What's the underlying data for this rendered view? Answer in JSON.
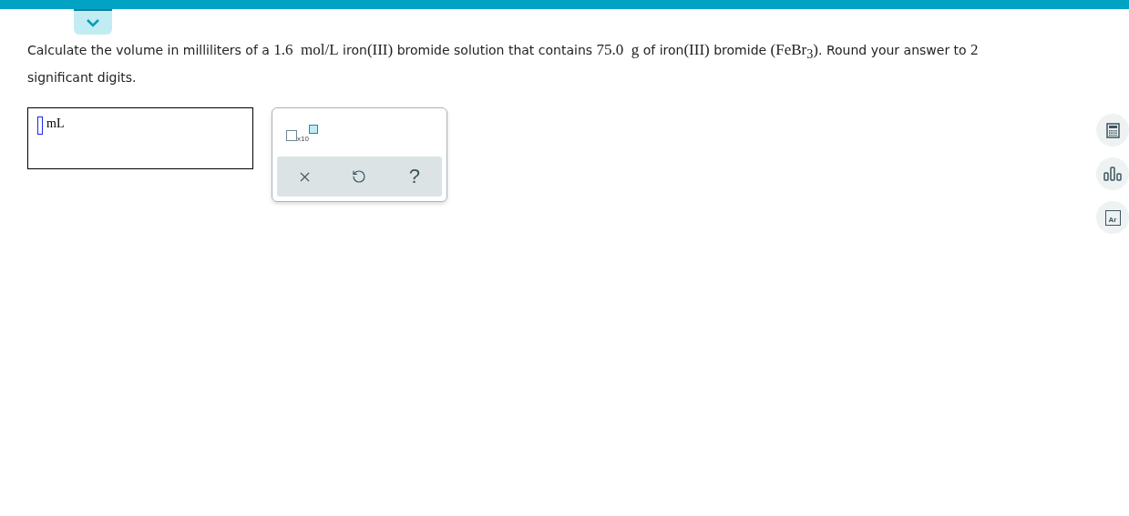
{
  "question": [
    {
      "kind": "text",
      "text": "Calculate the volume in milliliters of a "
    },
    {
      "kind": "math",
      "text": "1.6  mol/L"
    },
    {
      "kind": "text",
      "text": " iron"
    },
    {
      "kind": "math",
      "text": "(III)"
    },
    {
      "kind": "text",
      "text": " bromide solution that contains "
    },
    {
      "kind": "math",
      "text": "75.0  g"
    },
    {
      "kind": "text",
      "text": " of iron"
    },
    {
      "kind": "math",
      "text": "(III)"
    },
    {
      "kind": "text",
      "text": " bromide "
    },
    {
      "kind": "formula",
      "text": "(FeBr$_{3}$)"
    },
    {
      "kind": "text",
      "text": ". Round your answer to "
    },
    {
      "kind": "math",
      "text": "2"
    },
    {
      "kind": "text",
      "text": " significant digits."
    }
  ],
  "answer": {
    "unit": "mL"
  },
  "palette": {
    "notation": "x10",
    "actions": [
      {
        "kind": "clear"
      },
      {
        "kind": "undo"
      },
      {
        "kind": "help",
        "text": "?"
      }
    ]
  },
  "tools": [
    {
      "kind": "calculator"
    },
    {
      "kind": "chart"
    },
    {
      "kind": "periodic",
      "symbol": "Ar"
    }
  ]
}
